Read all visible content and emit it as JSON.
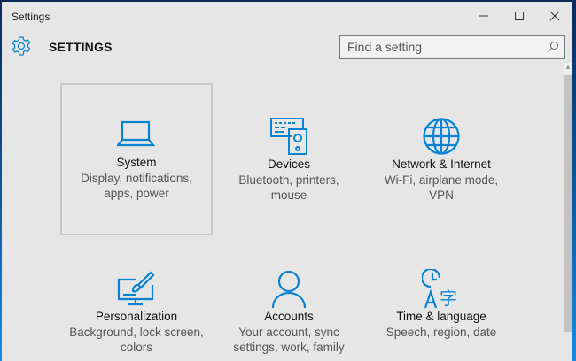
{
  "window": {
    "title": "Settings"
  },
  "header": {
    "title": "SETTINGS",
    "search_placeholder": "Find a setting"
  },
  "accent": "#0a84d0",
  "tiles": [
    {
      "title": "System",
      "subtitle": "Display, notifications, apps, power",
      "icon": "laptop-icon"
    },
    {
      "title": "Devices",
      "subtitle": "Bluetooth, printers, mouse",
      "icon": "devices-icon"
    },
    {
      "title": "Network & Internet",
      "subtitle": "Wi-Fi, airplane mode, VPN",
      "icon": "globe-icon"
    },
    {
      "title": "Personalization",
      "subtitle": "Background, lock screen, colors",
      "icon": "personalization-icon"
    },
    {
      "title": "Accounts",
      "subtitle": "Your account, sync settings, work, family",
      "icon": "person-icon"
    },
    {
      "title": "Time & language",
      "subtitle": "Speech, region, date",
      "icon": "time-language-icon"
    }
  ]
}
